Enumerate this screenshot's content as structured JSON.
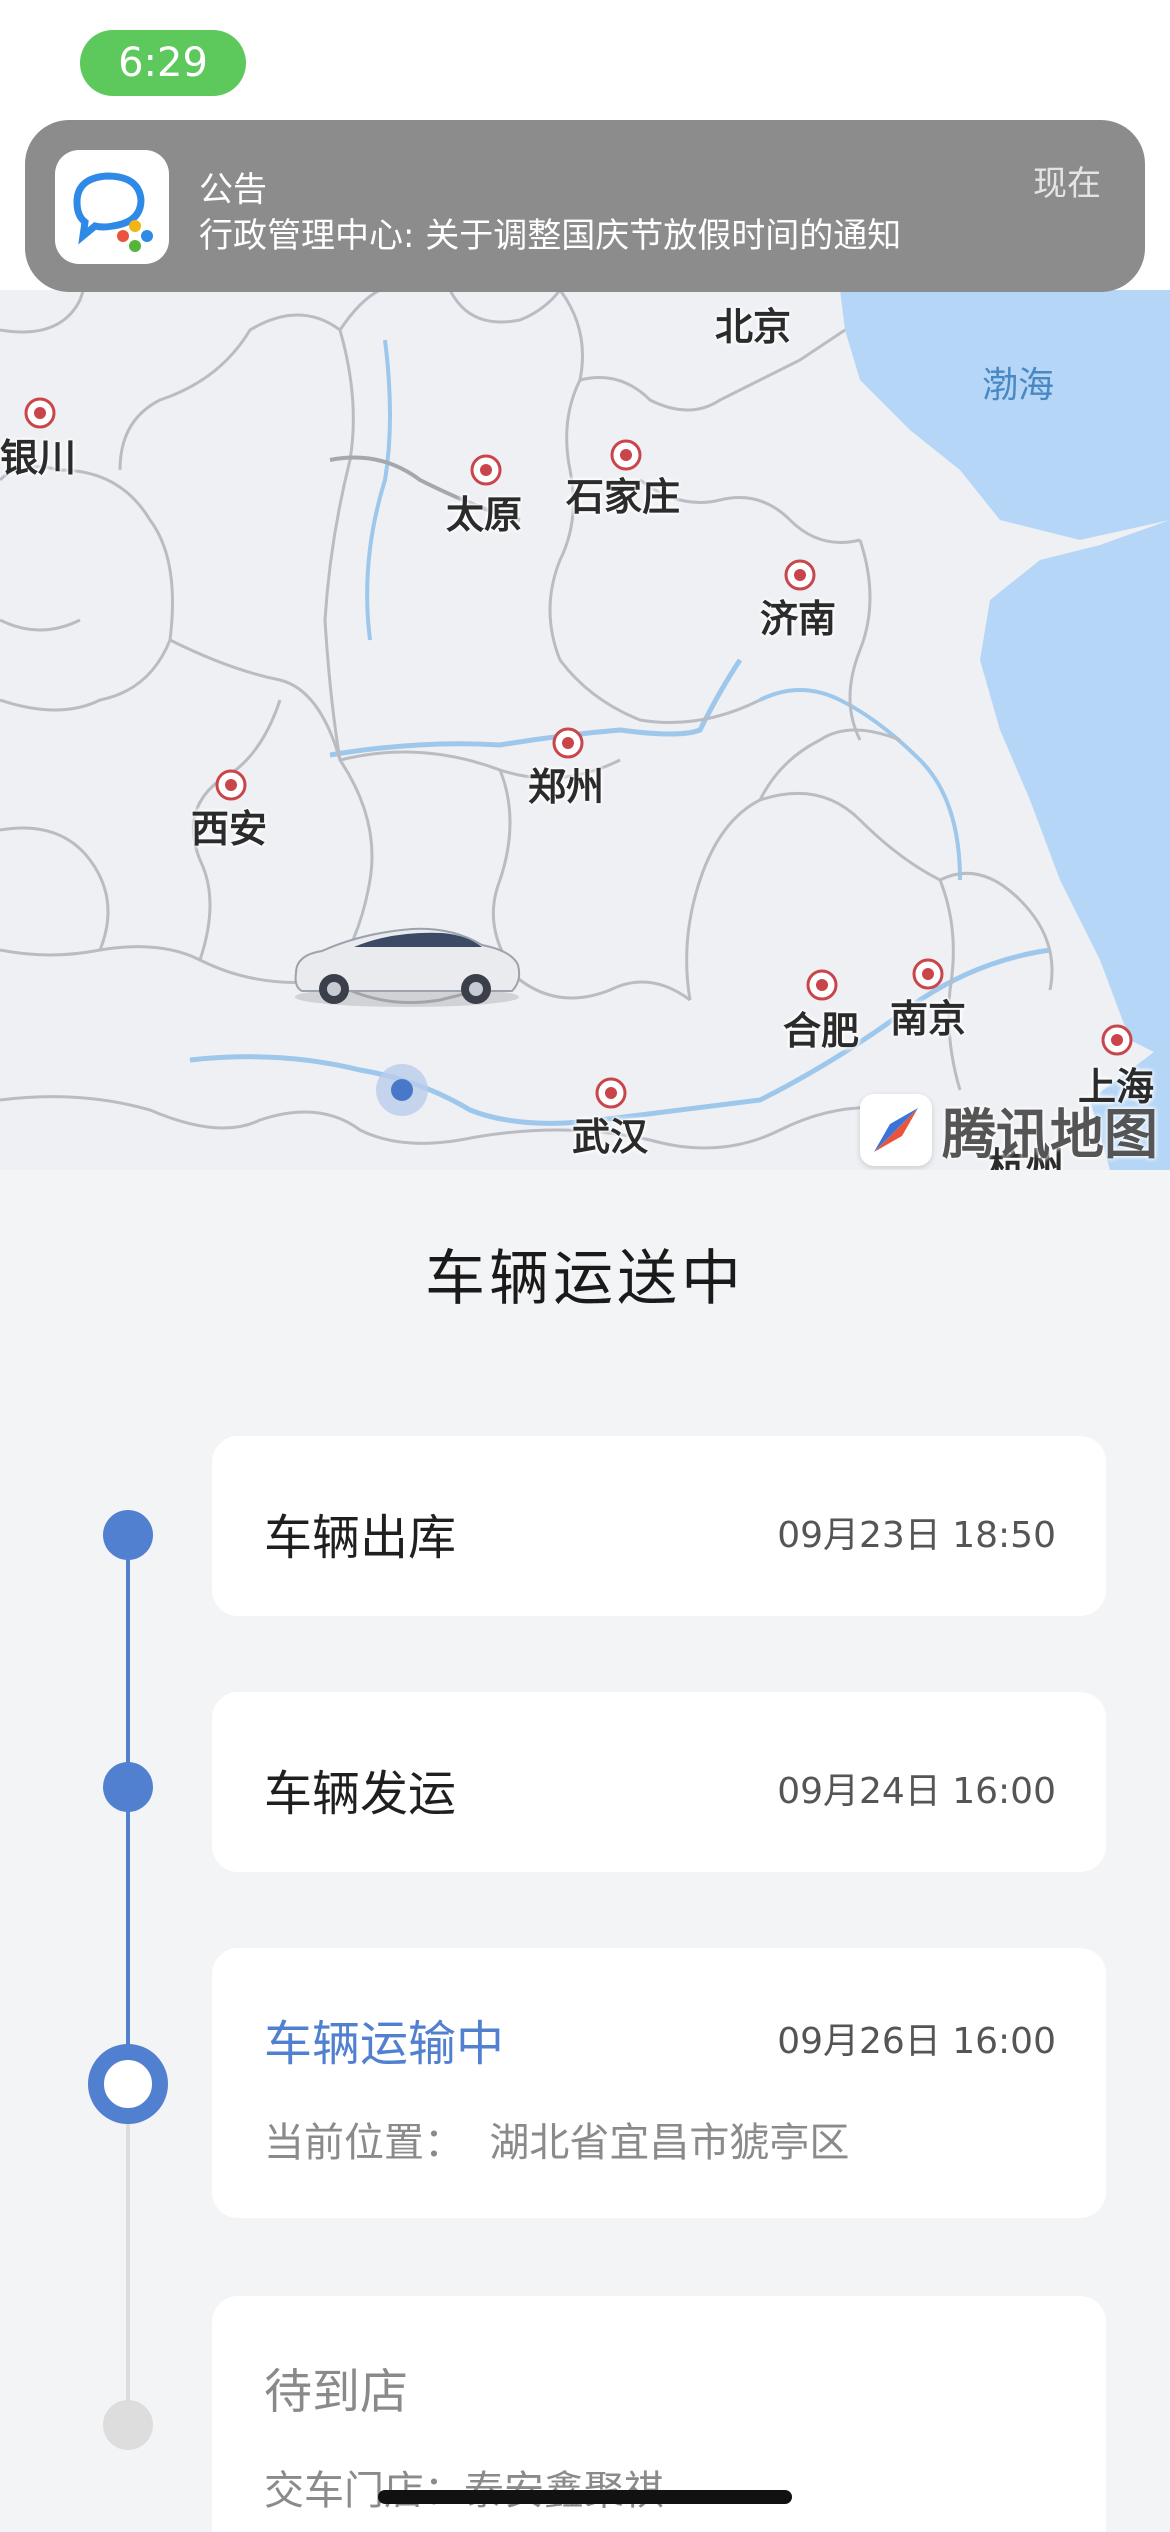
{
  "status_bar": {
    "time": "6:29"
  },
  "notification": {
    "app_icon": "wecom-chat-icon",
    "title": "公告",
    "body": "行政管理中心: 关于调整国庆节放假时间的通知",
    "time": "现在"
  },
  "map": {
    "cities": [
      "北京",
      "银川",
      "太原",
      "石家庄",
      "济南",
      "郑州",
      "西安",
      "合肥",
      "南京",
      "上海",
      "武汉",
      "杭州"
    ],
    "sea": "渤海",
    "brand": "腾讯地图",
    "vehicle_icon": "car-icon",
    "current_location_icon": "location-dot-icon"
  },
  "tracking": {
    "heading": "车辆运送中",
    "steps": [
      {
        "title": "车辆出库",
        "time": "09月23日 18:50",
        "detail": "",
        "state": "done"
      },
      {
        "title": "车辆发运",
        "time": "09月24日 16:00",
        "detail": "",
        "state": "done"
      },
      {
        "title": "车辆运输中",
        "time": "09月26日 16:00",
        "detail": "当前位置：  湖北省宜昌市猇亭区",
        "state": "current"
      },
      {
        "title": "待到店",
        "time": "",
        "detail": "交车门店：泰安鑫聚祺",
        "state": "pending"
      }
    ]
  },
  "colors": {
    "accent": "#5180d0",
    "pending": "#dddddd",
    "notification_bg": "#8c8c8c",
    "status_pill": "#5dc95d",
    "water": "#a9d0f4"
  }
}
